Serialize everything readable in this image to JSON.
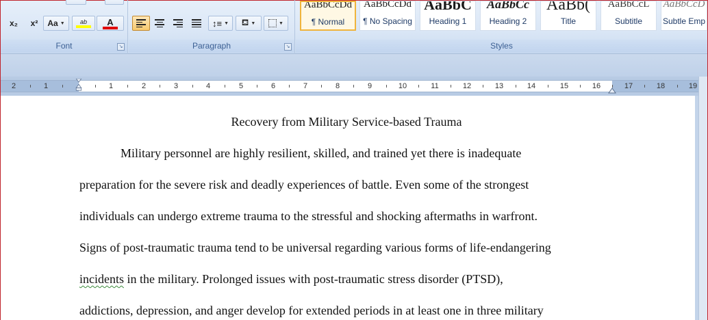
{
  "ribbon": {
    "font_group": {
      "label": "Font",
      "subscript": "x₂",
      "superscript": "x²",
      "change_case": "Aa",
      "highlight": "ab",
      "font_color": "A",
      "highlight_color": "#ffff00",
      "font_color_value": "#e00000"
    },
    "paragraph_group": {
      "label": "Paragraph"
    },
    "styles_group": {
      "label": "Styles",
      "tiles": [
        {
          "sample": "AaBbCcDd",
          "name": "¶ Normal"
        },
        {
          "sample": "AaBbCcDd",
          "name": "¶ No Spacing"
        },
        {
          "sample": "AaBbC",
          "name": "Heading 1"
        },
        {
          "sample": "AaBbCc",
          "name": "Heading 2"
        },
        {
          "sample": "AaBb(",
          "name": "Title"
        },
        {
          "sample": "AaBbCcL",
          "name": "Subtitle"
        },
        {
          "sample": "AaBbCcD",
          "name": "Subtle Emp"
        }
      ]
    }
  },
  "ruler": {
    "labels": [
      "2",
      "1",
      "1",
      "2",
      "3",
      "4",
      "5",
      "6",
      "7",
      "8",
      "9",
      "10",
      "11",
      "12",
      "13",
      "14",
      "15",
      "16",
      "17",
      "18",
      "19"
    ]
  },
  "document": {
    "title": "Recovery from Military Service-based Trauma",
    "lines": [
      "Military personnel are highly resilient, skilled, and trained yet there is inadequate",
      "preparation for the severe risk and deadly experiences of battle. Even some of the strongest",
      "individuals can undergo extreme trauma to the stressful and shocking aftermaths in warfront.",
      "Signs of post-traumatic trauma tend to be universal regarding various forms of life-endangering",
      "in the military. Prolonged issues with post-traumatic stress disorder (PTSD),",
      "addictions, depression, and anger develop for extended periods in at least one in three military"
    ],
    "flagged_word": "incidents"
  }
}
